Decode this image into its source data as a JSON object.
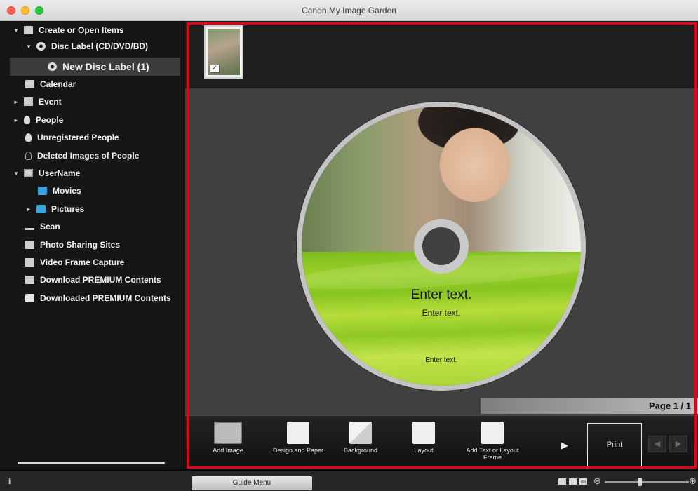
{
  "window": {
    "title": "Canon My Image Garden"
  },
  "sidebar": {
    "items": [
      {
        "label": "Create or Open Items",
        "icon": "create-items-icon",
        "arrow": "▼"
      },
      {
        "label": "Disc Label (CD/DVD/BD)",
        "icon": "disc-icon",
        "arrow": "▼"
      },
      {
        "label": "New Disc Label (1)",
        "icon": "disc-icon",
        "arrow": ""
      },
      {
        "label": "Calendar",
        "icon": "calendar-icon",
        "arrow": ""
      },
      {
        "label": "Event",
        "icon": "event-icon",
        "arrow": "►"
      },
      {
        "label": "People",
        "icon": "person-icon",
        "arrow": "►"
      },
      {
        "label": "Unregistered People",
        "icon": "unregistered-person-icon",
        "arrow": ""
      },
      {
        "label": "Deleted Images of People",
        "icon": "deleted-person-icon",
        "arrow": ""
      },
      {
        "label": "UserName",
        "icon": "computer-icon",
        "arrow": "▼"
      },
      {
        "label": "Movies",
        "icon": "folder-icon",
        "arrow": ""
      },
      {
        "label": "Pictures",
        "icon": "folder-icon",
        "arrow": "►"
      },
      {
        "label": "Scan",
        "icon": "scan-icon",
        "arrow": ""
      },
      {
        "label": "Photo Sharing Sites",
        "icon": "photo-sharing-icon",
        "arrow": ""
      },
      {
        "label": "Video Frame Capture",
        "icon": "video-frame-icon",
        "arrow": ""
      },
      {
        "label": "Download PREMIUM Contents",
        "icon": "download-icon",
        "arrow": ""
      },
      {
        "label": "Downloaded PREMIUM Contents",
        "icon": "folder-icon",
        "arrow": ""
      }
    ]
  },
  "disc": {
    "text_main": "Enter text.",
    "text_sub": "Enter text.",
    "text_bottom": "Enter text."
  },
  "page": {
    "indicator": "Page 1 / 1"
  },
  "toolbar": {
    "add_image": "Add Image",
    "design_paper": "Design and Paper",
    "background": "Background",
    "layout": "Layout",
    "add_text": "Add Text or Layout Frame",
    "print": "Print"
  },
  "statusbar": {
    "guide_menu": "Guide Menu",
    "info": "i"
  }
}
